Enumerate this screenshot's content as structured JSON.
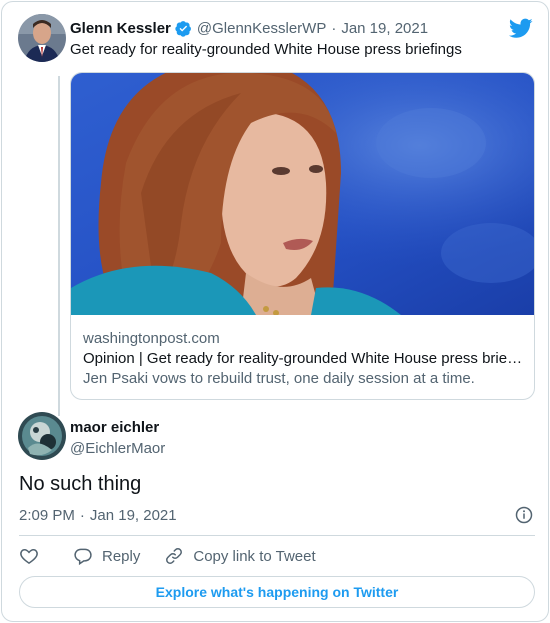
{
  "parent_tweet": {
    "author_name": "Glenn Kessler",
    "handle": "@GlennKesslerWP",
    "separator": "·",
    "date": "Jan 19, 2021",
    "text": "Get ready for reality-grounded White House press briefings",
    "link_card": {
      "domain": "washingtonpost.com",
      "title": "Opinion | Get ready for reality-grounded White House press briefings",
      "description": "Jen Psaki vows to rebuild trust, one daily session at a time."
    }
  },
  "tweet": {
    "author_name": "maor eichler",
    "handle": "@EichlerMaor",
    "text": "No such thing",
    "time": "2:09 PM",
    "separator": "·",
    "date": "Jan 19, 2021"
  },
  "actions": {
    "reply_label": "Reply",
    "copy_link_label": "Copy link to Tweet"
  },
  "explore_button": "Explore what's happening on Twitter",
  "colors": {
    "twitter_blue": "#1d9bf0",
    "muted_text": "#536471",
    "border": "#cfd9de"
  },
  "icons": [
    "verified-badge-icon",
    "twitter-bird-icon",
    "info-icon",
    "heart-icon",
    "reply-bubble-icon",
    "link-icon"
  ]
}
